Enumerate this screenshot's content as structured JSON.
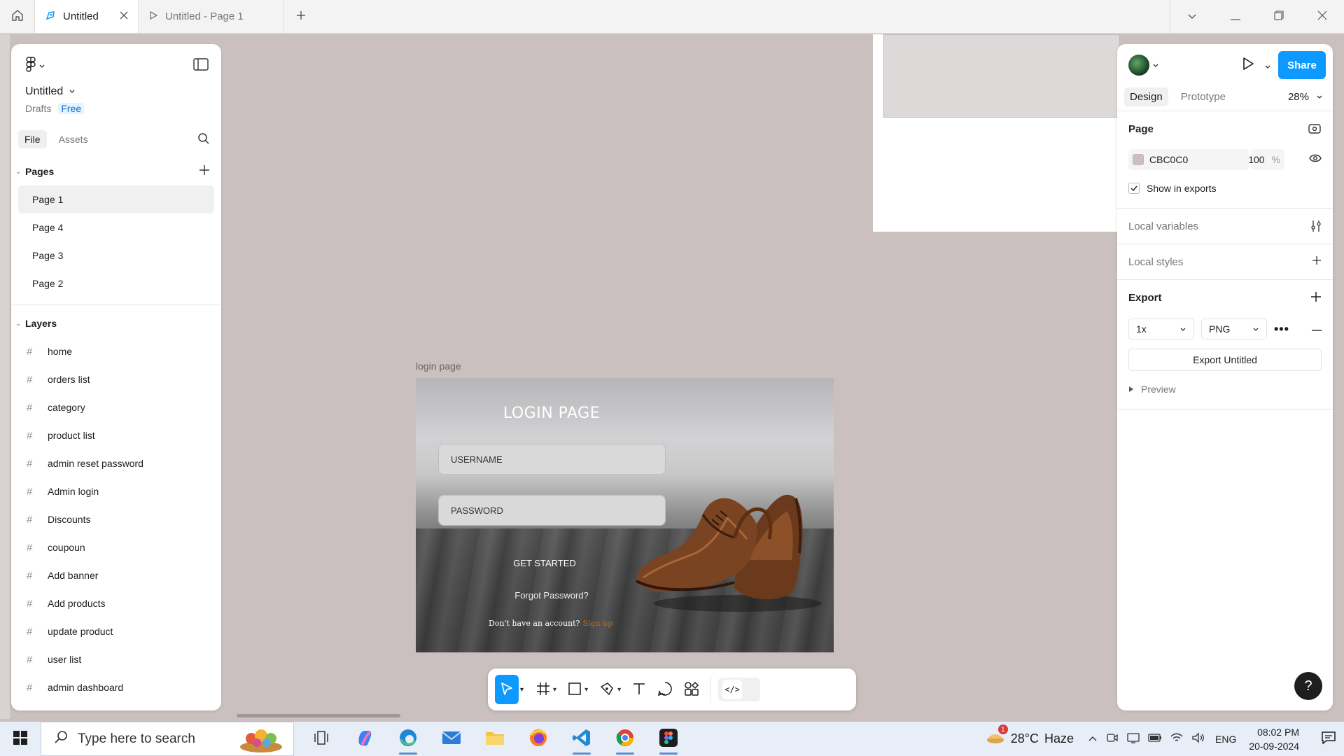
{
  "tabs": [
    {
      "label": "Untitled",
      "active": true
    },
    {
      "label": "Untitled - Page 1",
      "active": false
    }
  ],
  "canvas": {
    "frame_label": "login page",
    "login": {
      "title": "LOGIN PAGE",
      "username_placeholder": "USERNAME",
      "password_placeholder": "PASSWORD",
      "get_started": "GET STARTED",
      "forgot": "Forgot Password?",
      "no_account": "Don't have an account?",
      "signup": "Sign up"
    },
    "background_color": "#CBC0C0"
  },
  "left_panel": {
    "file_name": "Untitled",
    "location": "Drafts",
    "plan": "Free",
    "tabs": [
      "File",
      "Assets"
    ],
    "pages_heading": "Pages",
    "pages": [
      "Page 1",
      "Page 4",
      "Page 3",
      "Page 2"
    ],
    "layers_heading": "Layers",
    "layers": [
      "home",
      "orders list",
      "category",
      "product list",
      "admin reset password",
      "Admin login",
      "Discounts",
      "coupoun",
      "Add banner",
      "Add products",
      "update product",
      "user list",
      "admin dashboard"
    ]
  },
  "right_panel": {
    "share_label": "Share",
    "tabs": [
      "Design",
      "Prototype"
    ],
    "zoom": "28%",
    "page_heading": "Page",
    "page_color": "CBC0C0",
    "page_opacity": "100",
    "opacity_unit": "%",
    "show_in_exports": "Show in exports",
    "local_variables": "Local variables",
    "local_styles": "Local styles",
    "export_heading": "Export",
    "export_scale": "1x",
    "export_format": "PNG",
    "export_button": "Export Untitled",
    "preview": "Preview",
    "help": "?"
  },
  "taskbar": {
    "search_placeholder": "Type here to search",
    "weather_temp": "28°C",
    "weather_desc": "Haze",
    "weather_badge": "1",
    "language": "ENG",
    "time": "08:02 PM",
    "date": "20-09-2024"
  },
  "colors": {
    "accent": "#0D99FF",
    "canvas": "#CBC0C0"
  }
}
